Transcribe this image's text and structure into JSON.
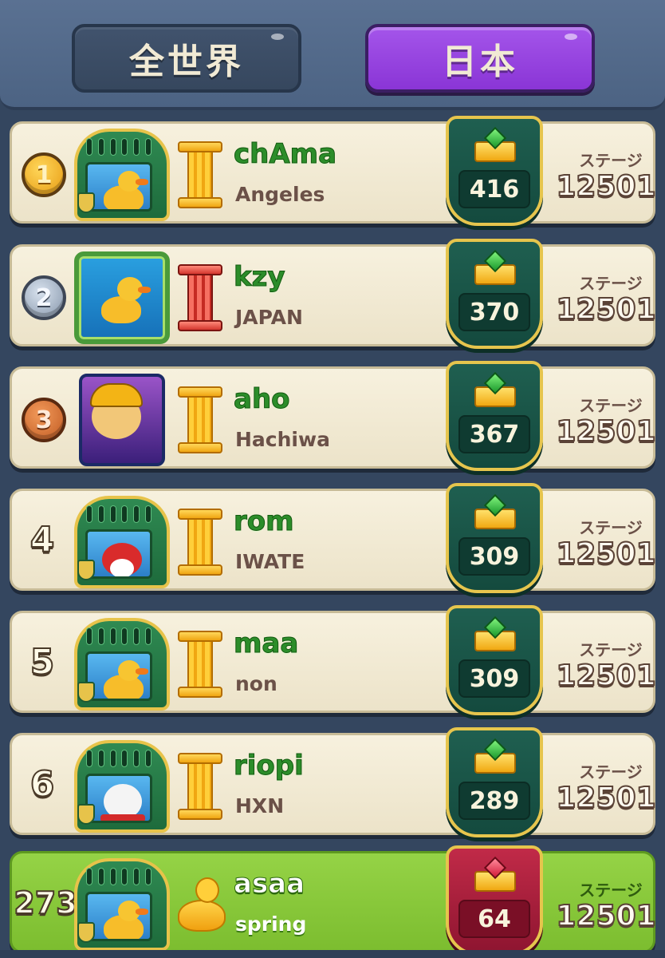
{
  "tabs": {
    "global": "全世界",
    "japan": "日本",
    "active": "japan"
  },
  "stage_label": "ステージ",
  "colors": {
    "background": "#34465f",
    "active_tab": "#9a46e2",
    "row": "#f4eedc",
    "my_row": "#8ac83c",
    "name_green": "#2c8d2a"
  },
  "rows": [
    {
      "rank": "1",
      "name": "chAma",
      "location": "Angeles",
      "crowns": "416",
      "stage": "12501",
      "medal": "gold"
    },
    {
      "rank": "2",
      "name": "kzy",
      "location": "JAPAN",
      "crowns": "370",
      "stage": "12501",
      "medal": "silver"
    },
    {
      "rank": "3",
      "name": "aho",
      "location": "Hachiwa",
      "crowns": "367",
      "stage": "12501",
      "medal": "bronze"
    },
    {
      "rank": "4",
      "name": "rom",
      "location": "IWATE",
      "crowns": "309",
      "stage": "12501"
    },
    {
      "rank": "5",
      "name": "maa",
      "location": "non",
      "crowns": "309",
      "stage": "12501"
    },
    {
      "rank": "6",
      "name": "riopi",
      "location": "HXN",
      "crowns": "289",
      "stage": "12501"
    }
  ],
  "me": {
    "rank": "273",
    "name": "asaa",
    "location": "spring",
    "crowns": "64",
    "stage": "12501"
  }
}
